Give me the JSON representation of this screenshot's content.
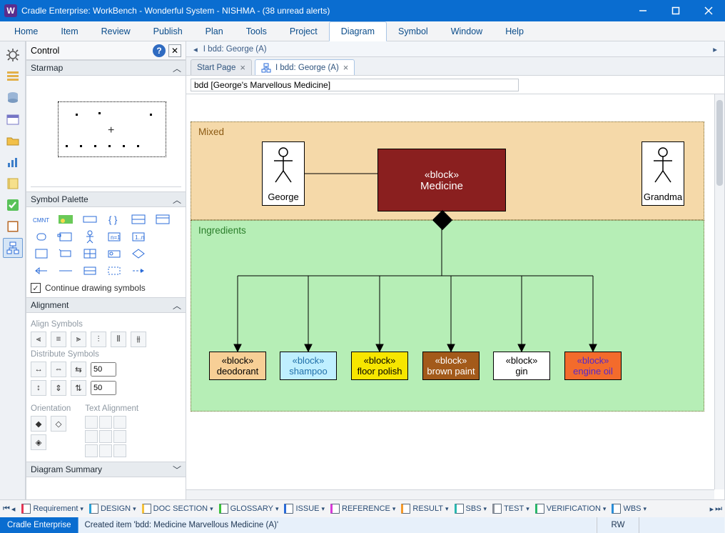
{
  "window": {
    "title": "Cradle Enterprise: WorkBench - Wonderful System - NISHMA - (38 unread alerts)",
    "app_letter": "W"
  },
  "menu": [
    "Home",
    "Item",
    "Review",
    "Publish",
    "Plan",
    "Tools",
    "Project",
    "Diagram",
    "Symbol",
    "Window",
    "Help"
  ],
  "menu_active": "Diagram",
  "sidebar": {
    "title": "Control",
    "sections": {
      "starmap": "Starmap",
      "palette": "Symbol Palette",
      "palette_continue": "Continue drawing symbols",
      "alignment": "Alignment",
      "align_symbols": "Align Symbols",
      "distribute_symbols": "Distribute Symbols",
      "dist_val1": "50",
      "dist_val2": "50",
      "orientation": "Orientation",
      "text_align": "Text Alignment",
      "summary": "Diagram Summary"
    }
  },
  "doc": {
    "breadcrumb": "I bdd: George (A)",
    "tab1": "Start Page",
    "tab2": "I bdd: George (A)",
    "name_field": "bdd [George's Marvellous Medicine]"
  },
  "diagram": {
    "region_mixed": "Mixed",
    "region_ingred": "Ingredients",
    "actor1": "George",
    "actor2": "Grandma",
    "main_stereo": "«block»",
    "main_name": "Medicine",
    "children": [
      {
        "stereo": "«block»",
        "name": "deodorant",
        "bg": "#f7cf96",
        "fg": "#000000"
      },
      {
        "stereo": "«block»",
        "name": "shampoo",
        "bg": "#bfefff",
        "fg": "#1f6fa8"
      },
      {
        "stereo": "«block»",
        "name": "floor polish",
        "bg": "#f7e600",
        "fg": "#000000"
      },
      {
        "stereo": "«block»",
        "name": "brown paint",
        "bg": "#a35a1a",
        "fg": "#ffffff"
      },
      {
        "stereo": "«block»",
        "name": "gin",
        "bg": "#ffffff",
        "fg": "#000000"
      },
      {
        "stereo": "«block»",
        "name": "engine oil",
        "bg": "#f36b2c",
        "fg": "#5529c9"
      }
    ]
  },
  "quickbar": {
    "items": [
      {
        "label": "Requirement",
        "c": "#e53554"
      },
      {
        "label": "DESIGN",
        "c": "#2aa3d8"
      },
      {
        "label": "DOC SECTION",
        "c": "#f5c23a"
      },
      {
        "label": "GLOSSARY",
        "c": "#3ac23a"
      },
      {
        "label": "ISSUE",
        "c": "#2a6bd8"
      },
      {
        "label": "REFERENCE",
        "c": "#d83ad8"
      },
      {
        "label": "RESULT",
        "c": "#f59a2a"
      },
      {
        "label": "SBS",
        "c": "#2ab7b0"
      },
      {
        "label": "TEST",
        "c": "#8a8f99"
      },
      {
        "label": "VERIFICATION",
        "c": "#2ab86a"
      },
      {
        "label": "WBS",
        "c": "#2a8ed8"
      }
    ]
  },
  "status": {
    "brand": "Cradle Enterprise",
    "message": "Created item 'bdd: Medicine Marvellous Medicine (A)'",
    "rw": "RW"
  }
}
